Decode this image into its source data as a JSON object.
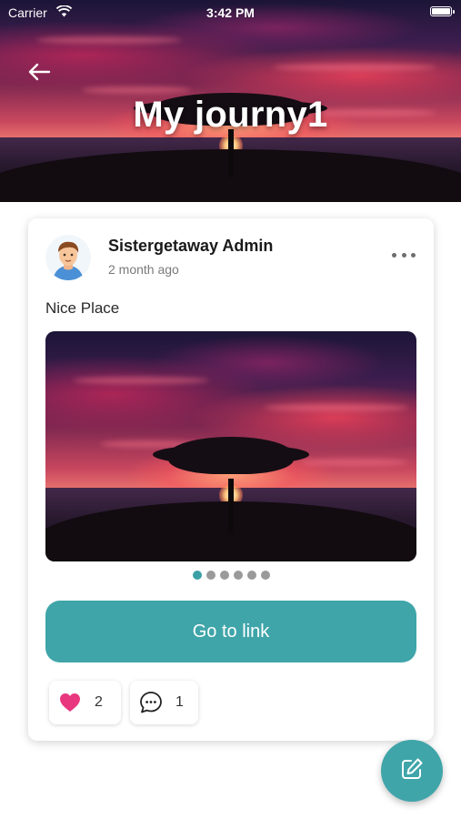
{
  "status_bar": {
    "carrier": "Carrier",
    "time": "3:42 PM"
  },
  "header": {
    "title": "My journy1"
  },
  "post": {
    "author": "Sistergetaway Admin",
    "time_ago": "2 month ago",
    "text": "Nice Place",
    "image_description": "sunset-tree-over-sea",
    "carousel": {
      "total": 6,
      "active_index": 0
    },
    "link_button_label": "Go to link",
    "likes": "2",
    "comments": "1"
  },
  "icons": {
    "back": "arrow-left-icon",
    "more": "more-horizontal-icon",
    "like": "heart-icon",
    "comment": "comment-bubble-icon",
    "fab": "edit-icon"
  },
  "colors": {
    "accent": "#3fa5a9",
    "like": "#e8377f",
    "dot_active": "#3aa0a5"
  }
}
